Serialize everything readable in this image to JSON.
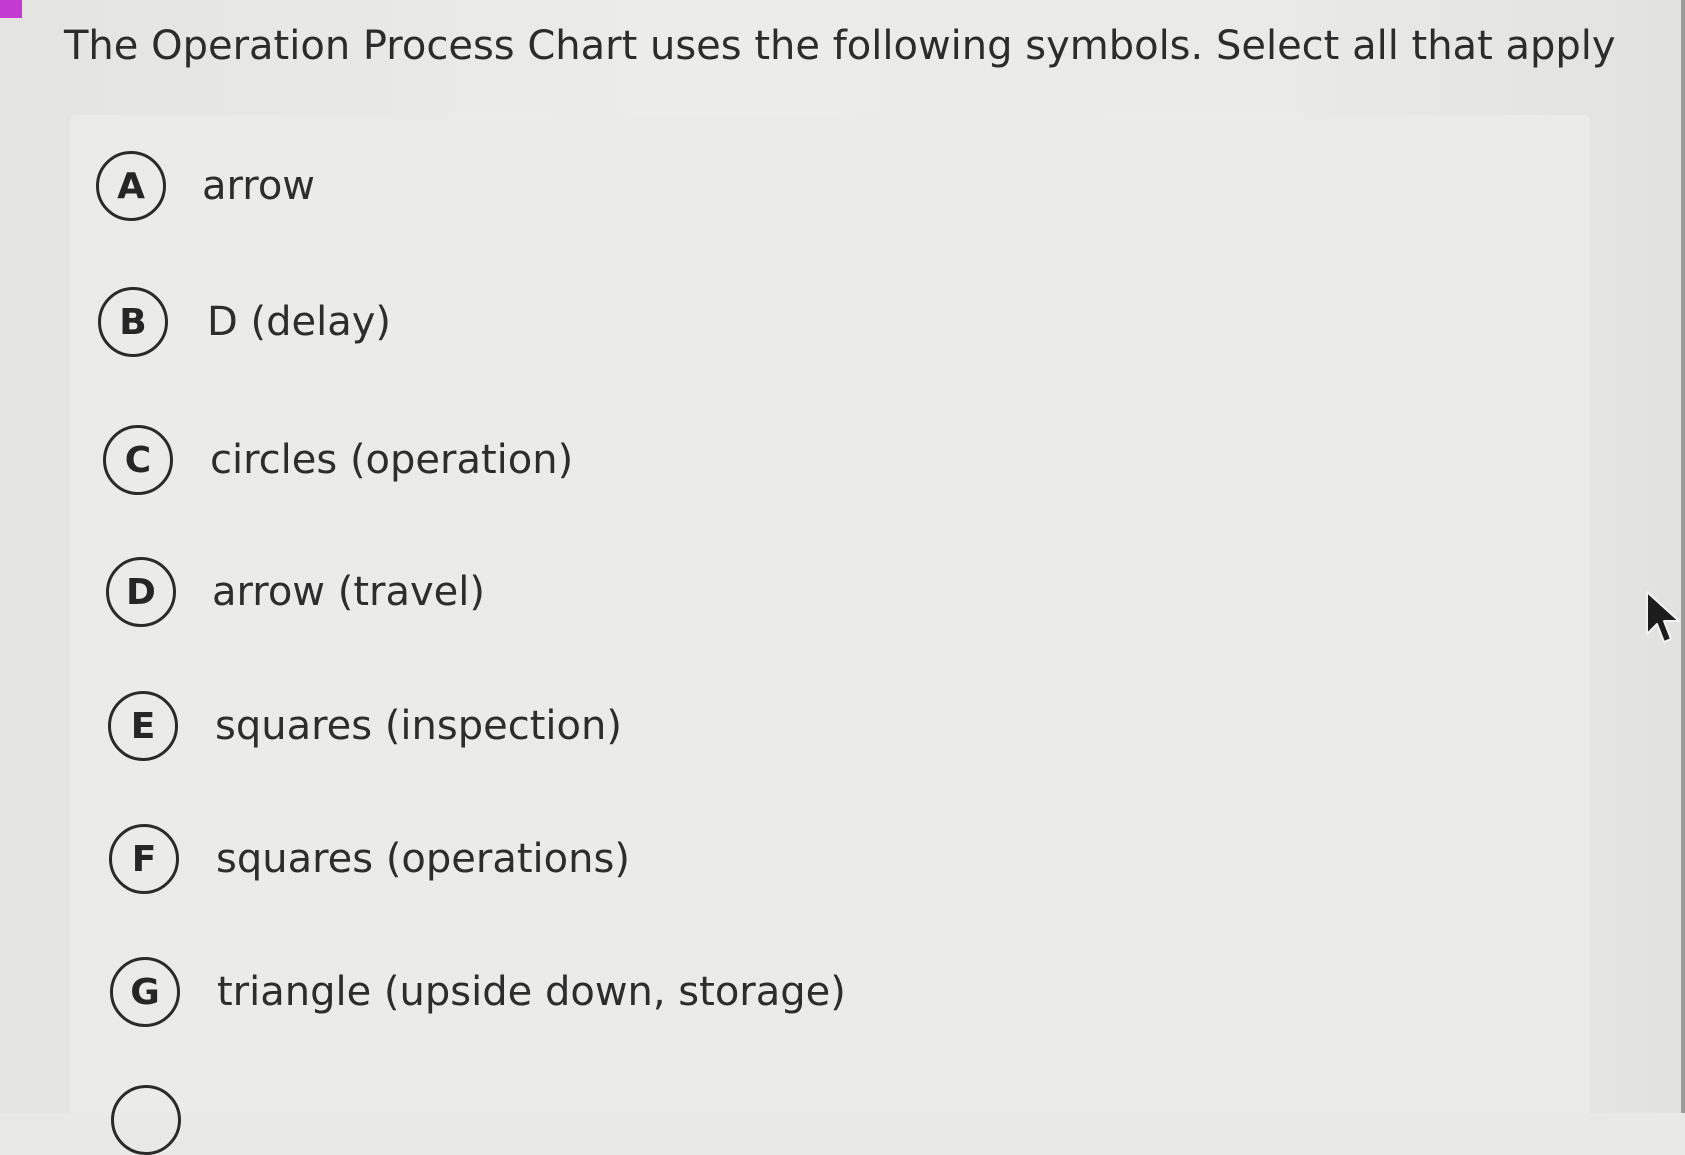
{
  "question": {
    "text": "The Operation Process Chart uses the following symbols. Select all that apply"
  },
  "options": [
    {
      "letter": "A",
      "text": "arrow"
    },
    {
      "letter": "B",
      "text": "D (delay)"
    },
    {
      "letter": "C",
      "text": "circles (operation)"
    },
    {
      "letter": "D",
      "text": "arrow (travel)"
    },
    {
      "letter": "E",
      "text": "squares (inspection)"
    },
    {
      "letter": "F",
      "text": "squares (operations)"
    },
    {
      "letter": "G",
      "text": "triangle (upside down, storage)"
    }
  ],
  "cursor": {
    "icon": "mouse-pointer-icon"
  }
}
